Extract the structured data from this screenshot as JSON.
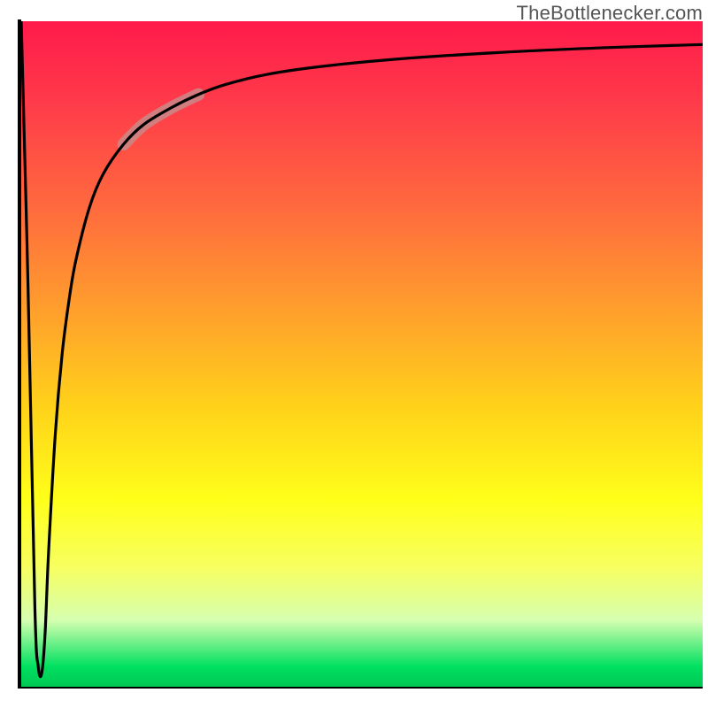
{
  "watermark_text": "TheBottlenecker.com",
  "chart_data": {
    "type": "line",
    "title": "",
    "xlabel": "",
    "ylabel": "",
    "xlim": [
      0,
      100
    ],
    "ylim": [
      0,
      100
    ],
    "series": [
      {
        "name": "bottleneck-curve",
        "x": [
          0.0,
          1.0,
          2.0,
          2.5,
          3.0,
          3.5,
          4.0,
          5.0,
          6.0,
          7.0,
          8.0,
          10.0,
          12.0,
          15.0,
          18.0,
          22.0,
          26.0,
          30.0,
          36.0,
          44.0,
          55.0,
          70.0,
          85.0,
          100.0
        ],
        "values": [
          100.0,
          60.0,
          12.0,
          3.0,
          2.0,
          8.0,
          20.0,
          38.0,
          50.0,
          58.0,
          64.0,
          72.0,
          77.0,
          81.5,
          84.5,
          87.0,
          89.0,
          90.5,
          92.0,
          93.2,
          94.3,
          95.3,
          96.0,
          96.5
        ]
      }
    ],
    "highlight_segment": {
      "series": "bottleneck-curve",
      "start_index": 13,
      "end_index": 16,
      "color": "#c98a88",
      "width": 14
    },
    "background_gradient": {
      "direction": "vertical",
      "stops": [
        {
          "pos": 0.0,
          "color": "#ff1a4b"
        },
        {
          "pos": 0.28,
          "color": "#ff6a3e"
        },
        {
          "pos": 0.58,
          "color": "#ffd21a"
        },
        {
          "pos": 0.82,
          "color": "#f7ff60"
        },
        {
          "pos": 0.97,
          "color": "#00e060"
        },
        {
          "pos": 1.0,
          "color": "#00c853"
        }
      ]
    }
  }
}
